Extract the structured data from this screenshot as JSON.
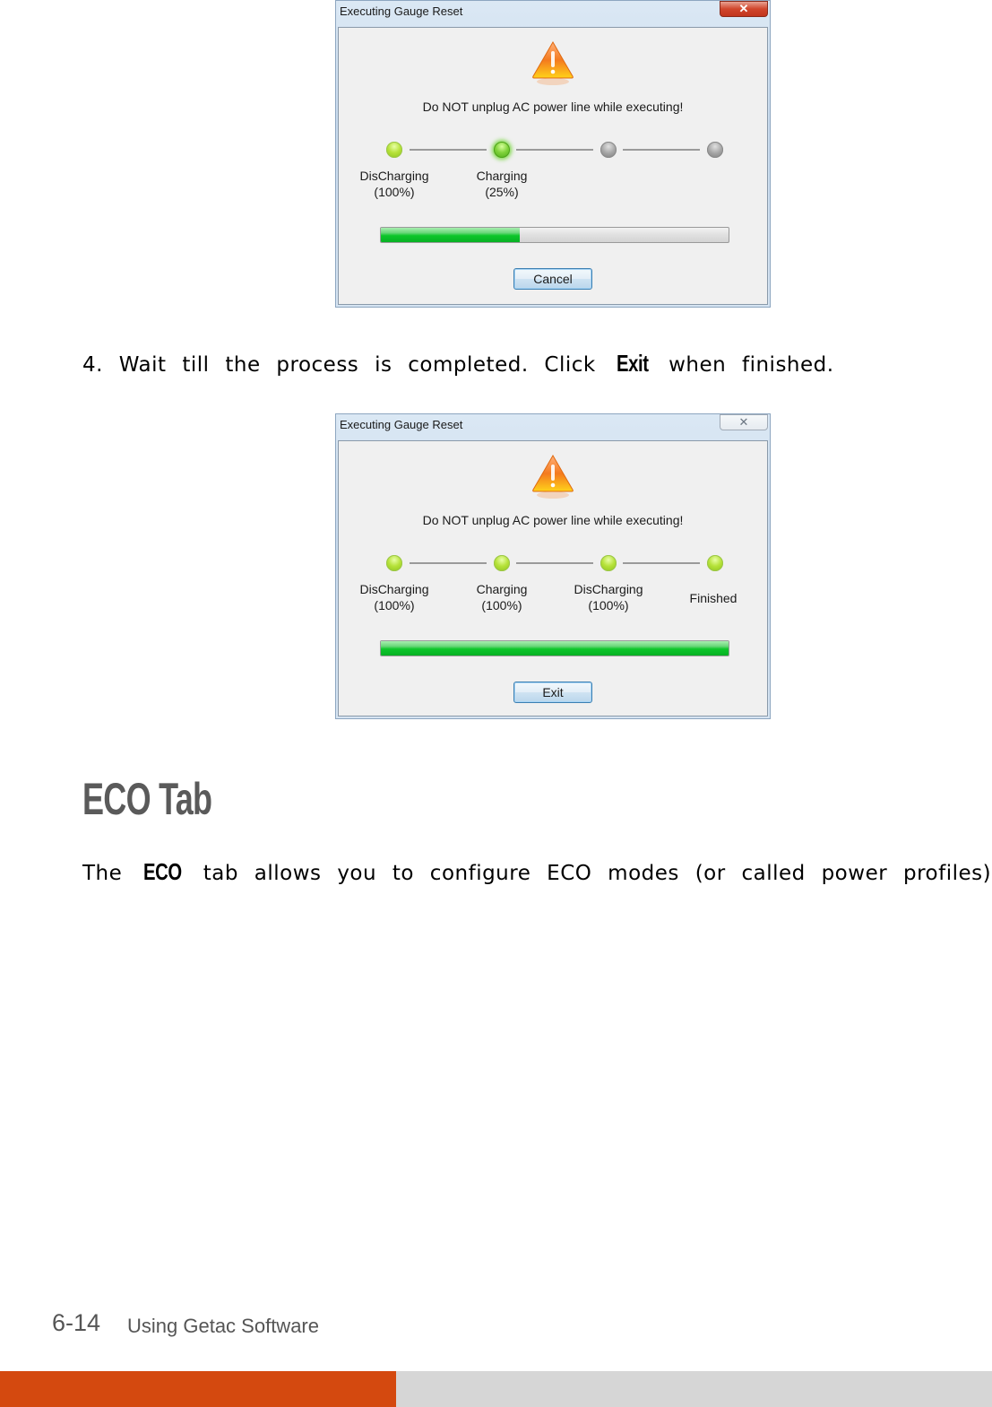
{
  "dialog1": {
    "title": "Executing Gauge Reset",
    "close_label": "✕",
    "warning": "Do NOT unplug AC power line while executing!",
    "steps": [
      {
        "label": "DisCharging",
        "detail": "(100%)",
        "state": "done"
      },
      {
        "label": "Charging",
        "detail": "(25%)",
        "state": "active"
      },
      {
        "label": "",
        "detail": "",
        "state": "pending"
      },
      {
        "label": "",
        "detail": "",
        "state": "pending"
      }
    ],
    "progress_percent": 40,
    "button_label": "Cancel"
  },
  "step4": {
    "number": "4.",
    "text_before": "Wait till the process is completed. Click",
    "term": "Exit",
    "text_after": "when finished."
  },
  "dialog2": {
    "title": "Executing Gauge Reset",
    "close_label": "✕",
    "warning": "Do NOT unplug AC power line while executing!",
    "steps": [
      {
        "label": "DisCharging",
        "detail": "(100%)",
        "state": "done"
      },
      {
        "label": "Charging",
        "detail": "(100%)",
        "state": "done"
      },
      {
        "label": "DisCharging",
        "detail": "(100%)",
        "state": "done"
      },
      {
        "label": "Finished",
        "detail": "",
        "state": "done"
      }
    ],
    "progress_percent": 100,
    "button_label": "Exit"
  },
  "section": {
    "heading": "ECO Tab",
    "body_before": "The",
    "term": "ECO",
    "body_after": "tab allows you to configure ECO modes (or called power profiles)."
  },
  "footer": {
    "page_number": "6-14",
    "chapter_title": "Using Getac Software",
    "accent_color": "#d4490f",
    "bar_gray": "#d6d6d6"
  }
}
